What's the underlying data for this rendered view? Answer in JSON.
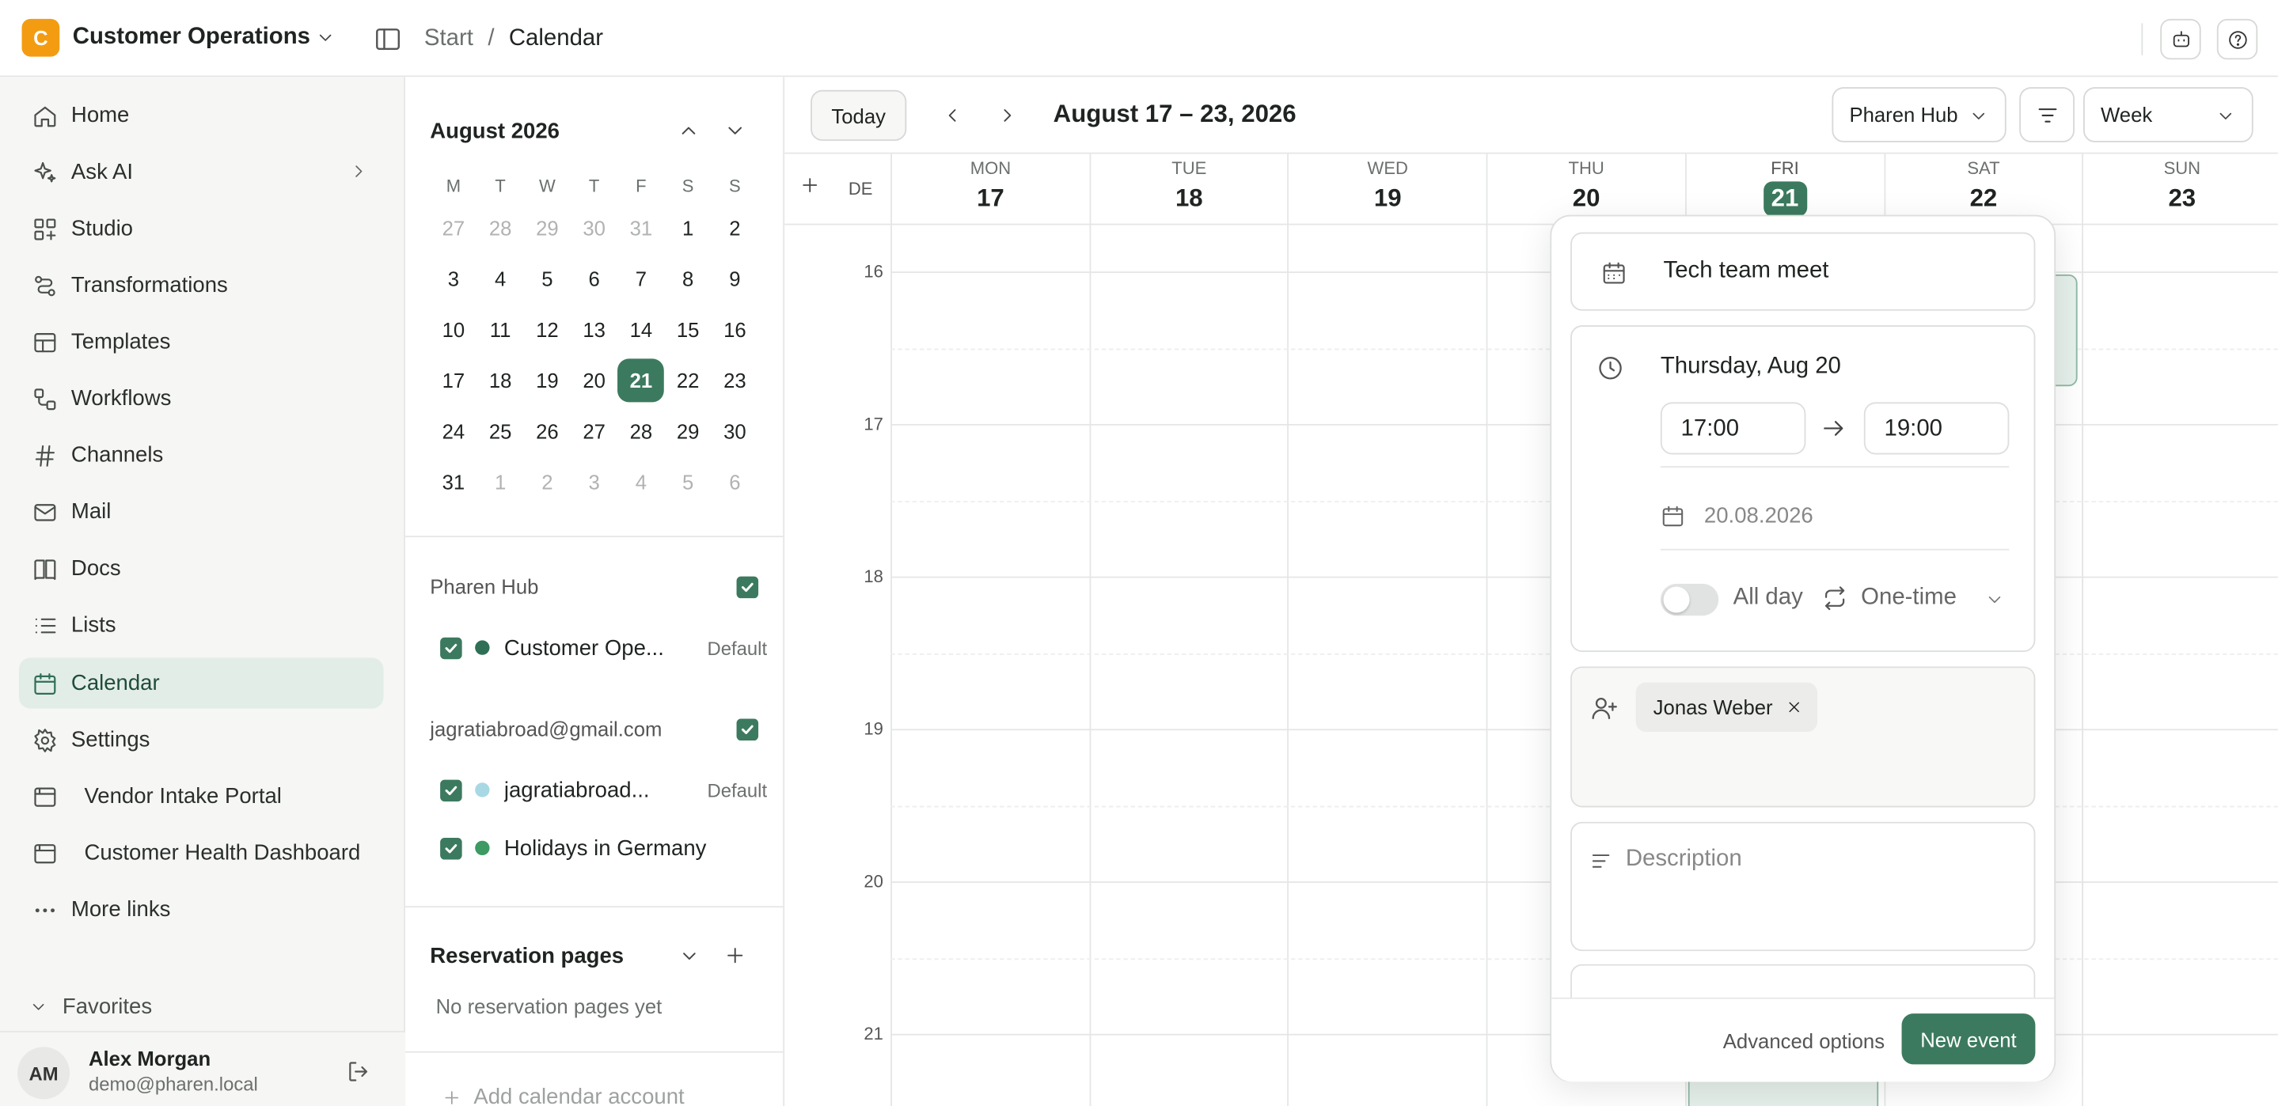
{
  "workspace": {
    "initial": "C",
    "name": "Customer Operations"
  },
  "breadcrumb": {
    "root": "Start",
    "sep": "/",
    "current": "Calendar"
  },
  "sidebar": {
    "items": [
      {
        "label": "Home",
        "icon": "home-icon"
      },
      {
        "label": "Ask AI",
        "icon": "sparkle-icon"
      },
      {
        "label": "Studio",
        "icon": "studio-icon"
      },
      {
        "label": "Transformations",
        "icon": "transform-icon"
      },
      {
        "label": "Templates",
        "icon": "template-icon"
      },
      {
        "label": "Workflows",
        "icon": "workflow-icon"
      },
      {
        "label": "Channels",
        "icon": "hash-icon"
      },
      {
        "label": "Mail",
        "icon": "mail-icon"
      },
      {
        "label": "Docs",
        "icon": "book-icon"
      },
      {
        "label": "Lists",
        "icon": "list-icon"
      },
      {
        "label": "Calendar",
        "icon": "calendar-icon",
        "active": true
      },
      {
        "label": "Settings",
        "icon": "gear-icon"
      },
      {
        "label": "Vendor Intake Portal",
        "icon": "window-icon"
      },
      {
        "label": "Customer Health Dashboard",
        "icon": "window-icon"
      },
      {
        "label": "More links",
        "icon": "more-icon"
      }
    ],
    "favorites": "Favorites"
  },
  "user": {
    "initials": "AM",
    "name": "Alex Morgan",
    "email": "demo@pharen.local"
  },
  "mini_calendar": {
    "title": "August 2026",
    "weekdays": [
      "M",
      "T",
      "W",
      "T",
      "F",
      "S",
      "S"
    ],
    "weeks": [
      [
        "27",
        "28",
        "29",
        "30",
        "31",
        "1",
        "2"
      ],
      [
        "3",
        "4",
        "5",
        "6",
        "7",
        "8",
        "9"
      ],
      [
        "10",
        "11",
        "12",
        "13",
        "14",
        "15",
        "16"
      ],
      [
        "17",
        "18",
        "19",
        "20",
        "21",
        "22",
        "23"
      ],
      [
        "24",
        "25",
        "26",
        "27",
        "28",
        "29",
        "30"
      ],
      [
        "31",
        "1",
        "2",
        "3",
        "4",
        "5",
        "6"
      ]
    ]
  },
  "calendars": {
    "group1": {
      "label": "Pharen Hub",
      "items": [
        {
          "name": "Customer Ope...",
          "tag": "Default",
          "color": "#2f6f55"
        }
      ]
    },
    "group2": {
      "label": "jagratiabroad@gmail.com",
      "items": [
        {
          "name": "jagratiabroad...",
          "tag": "Default",
          "color": "#a8d8e4"
        },
        {
          "name": "Holidays in Germany",
          "tag": "",
          "color": "#3c9a62"
        }
      ]
    }
  },
  "reservation": {
    "title": "Reservation pages",
    "empty": "No reservation pages yet"
  },
  "add_account": "Add calendar account",
  "toolbar": {
    "today": "Today",
    "range": "August 17 – 23, 2026",
    "hub": "Pharen Hub",
    "view": "Week"
  },
  "week": {
    "tz": "DE",
    "days": [
      {
        "name": "MON",
        "date": "17"
      },
      {
        "name": "TUE",
        "date": "18"
      },
      {
        "name": "WED",
        "date": "19"
      },
      {
        "name": "THU",
        "date": "20"
      },
      {
        "name": "FRI",
        "date": "21"
      },
      {
        "name": "SAT",
        "date": "22"
      },
      {
        "name": "SUN",
        "date": "23"
      }
    ],
    "hours": [
      "16",
      "17",
      "18",
      "19",
      "20",
      "21"
    ]
  },
  "event_form": {
    "title": "Tech team meet",
    "date_label": "Thursday, Aug 20",
    "start": "17:00",
    "end": "19:00",
    "date_field": "20.08.2026",
    "allday": "All day",
    "repeat": "One-time",
    "guest": "Jonas Weber",
    "description_placeholder": "Description",
    "advanced": "Advanced options",
    "submit": "New event"
  },
  "colors": {
    "accent": "#3c7a5f",
    "accent_light": "#e3ede8",
    "workspace": "#f39c12"
  }
}
